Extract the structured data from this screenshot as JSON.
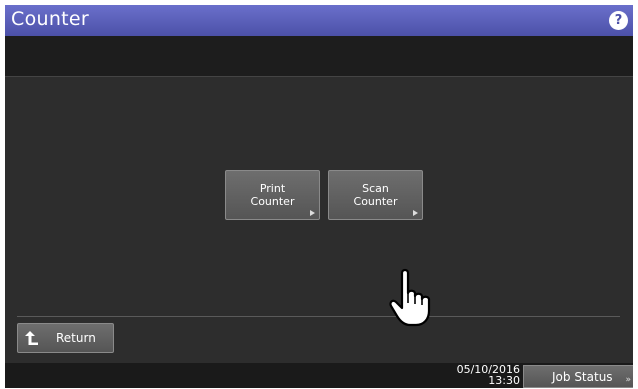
{
  "header": {
    "title": "Counter",
    "help_label": "?"
  },
  "menu": {
    "print_counter": "Print\nCounter",
    "scan_counter": "Scan\nCounter"
  },
  "footer": {
    "return_label": "Return",
    "date": "05/10/2016",
    "time": "13:30",
    "job_status_label": "Job Status",
    "job_status_arrow": "»"
  },
  "icons": {
    "help": "question-mark-icon",
    "return": "return-arrow-icon",
    "pointer": "hand-pointer-icon",
    "button_arrow": "triangle-right-icon"
  },
  "colors": {
    "title_bar": "#5b60bd",
    "background": "#2d2d2d",
    "button": "#616161"
  }
}
